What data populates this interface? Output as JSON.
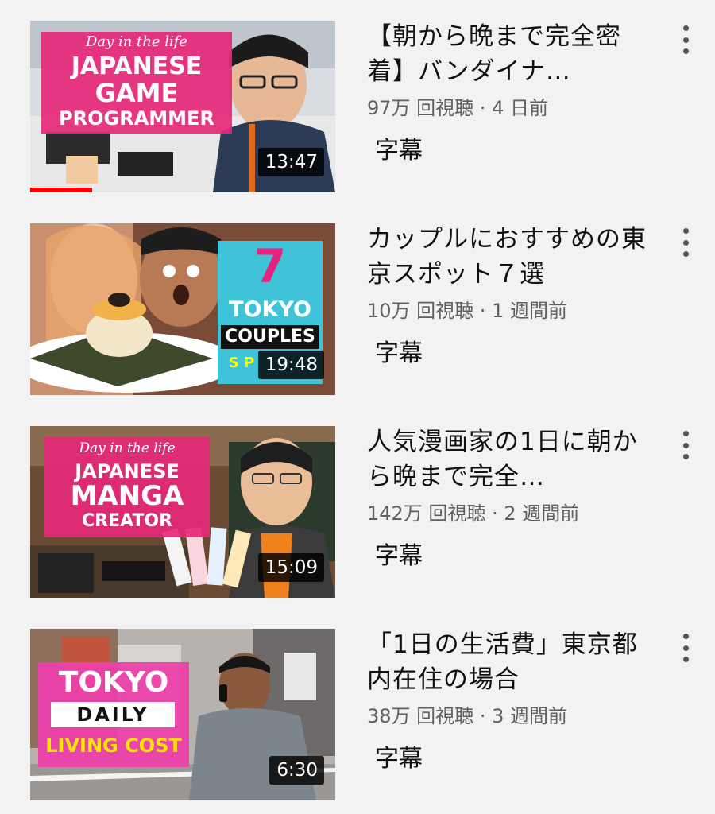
{
  "colors": {
    "background": "#f2f2f2",
    "progress": "#ff0000",
    "meta_text": "#606060"
  },
  "icons": {
    "more": "more-vertical-icon"
  },
  "videos": [
    {
      "title": "【朝から晩まで完全密着】バンダイナ…",
      "views": "97万 回視聴",
      "age": "4 日前",
      "badge": "字幕",
      "duration": "13:47",
      "watched_fraction": 0.2,
      "thumb_text": {
        "script": "Day in the life",
        "line1": "JAPANESE",
        "line2": "GAME",
        "line3": "PROGRAMMER"
      }
    },
    {
      "title": "カップルにおすすめの東京スポット７選",
      "views": "10万 回視聴",
      "age": "1 週間前",
      "badge": "字幕",
      "duration": "19:48",
      "thumb_text": {
        "number": "7",
        "line1": "TOKYO",
        "line2": "COUPLES",
        "line3": "S P"
      }
    },
    {
      "title": "人気漫画家の1日に朝から晩まで完全…",
      "views": "142万 回視聴",
      "age": "2 週間前",
      "badge": "字幕",
      "duration": "15:09",
      "thumb_text": {
        "script": "Day in the life",
        "line1": "JAPANESE",
        "line2": "MANGA",
        "line3": "CREATOR"
      }
    },
    {
      "title": "「1日の生活費」東京都内在住の場合",
      "views": "38万 回視聴",
      "age": "3 週間前",
      "badge": "字幕",
      "duration": "6:30",
      "thumb_text": {
        "line1": "TOKYO",
        "line2": "DAILY",
        "line3": "LIVING COST"
      }
    }
  ]
}
